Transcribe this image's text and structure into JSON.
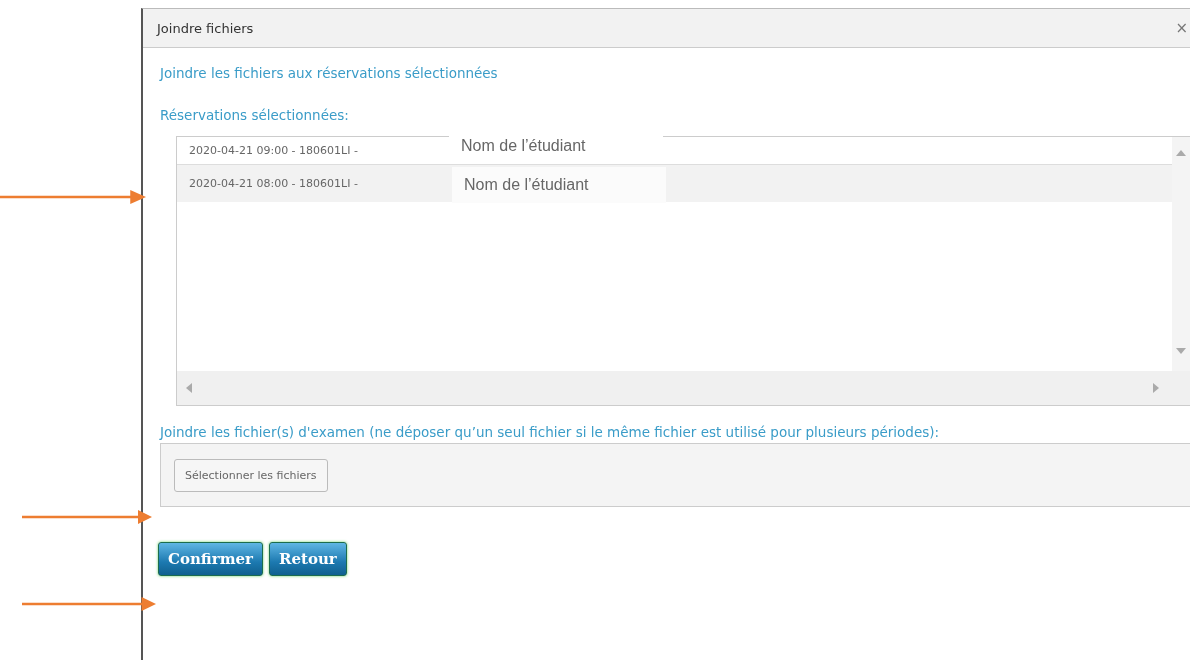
{
  "window": {
    "title": "Joindre fichiers",
    "close": "×"
  },
  "heading": "Joindre les fichiers aux réservations sélectionnées",
  "reservations": {
    "label": "Réservations sélectionnées:",
    "rows": [
      {
        "text": "2020-04-21 09:00 - 180601LI -",
        "overlay": "Nom de l’étudiant",
        "selected": false
      },
      {
        "text": "2020-04-21 08:00 - 180601LI -",
        "overlay": "Nom de l’étudiant",
        "selected": true
      }
    ]
  },
  "attach": {
    "label": "Joindre les fichier(s) d'examen (ne déposer qu’un seul fichier si le même fichier est utilisé pour plusieurs périodes):",
    "button": "Sélectionner les fichiers"
  },
  "buttons": [
    {
      "label": "Confirmer"
    },
    {
      "label": "Retour"
    }
  ],
  "annotations": [
    {
      "kind": "arrow"
    },
    {
      "kind": "arrow"
    },
    {
      "kind": "arrow"
    }
  ]
}
